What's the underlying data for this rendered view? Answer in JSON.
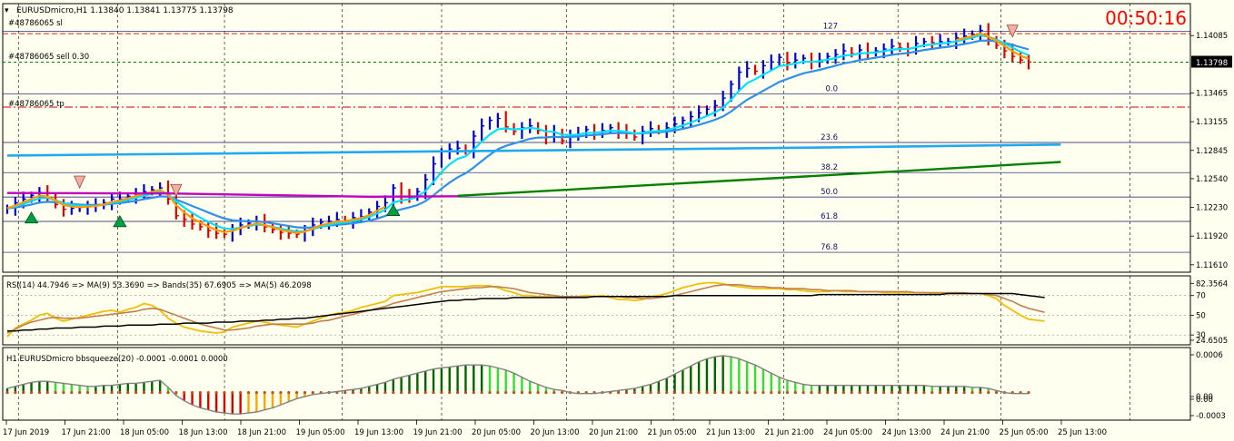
{
  "header": {
    "title": "EURUSDmicro,H1  1.13840 1.13841 1.13775 1.13798",
    "timer": "00:50:16"
  },
  "colors": {
    "background": "#fffff0",
    "frame": "#000000",
    "grid": "#000000",
    "bull": "#0000cd",
    "bear": "#e00000",
    "ma_fast": "#00e0ff",
    "ma_mid": "#3090e8",
    "ma_slow": "#20a8f0",
    "ma_long": "#008000",
    "ma_magenta": "#c000c0",
    "ma_orange": "#ff9900",
    "rsi": "#f0c000",
    "rsi_ma": "#c08050",
    "rsi_bands": "#000000",
    "hist_up_strong": "#006400",
    "hist_up_weak": "#33dd33",
    "hist_down_strong": "#dd0000",
    "hist_down_weak": "#ffa500",
    "timer": "#ff0000",
    "price_tag": "#000000"
  },
  "orders": {
    "sl": {
      "label": "#48786065 sl",
      "price": 1.14106
    },
    "entry": {
      "label": "#48786065 sell 0.30",
      "price": 1.13798
    },
    "tp": {
      "label": "#48786065 tp",
      "price": 1.13313
    }
  },
  "fibo": [
    {
      "label": "127",
      "price": 1.14133
    },
    {
      "label": "0.0",
      "price": 1.13457
    },
    {
      "label": "23.6",
      "price": 1.12931
    },
    {
      "label": "38.2",
      "price": 1.12606
    },
    {
      "label": "50.0",
      "price": 1.12342
    },
    {
      "label": "61.8",
      "price": 1.12079
    },
    {
      "label": "76.8",
      "price": 1.11745
    }
  ],
  "chart_data": [
    {
      "type": "bar",
      "title": "EURUSDmicro,H1",
      "ohlc_header": [
        "1.13840",
        "1.13841",
        "1.13775",
        "1.13798"
      ],
      "ylim": [
        1.1153,
        1.1443
      ],
      "y_ticks": [
        "1.14085",
        "1.13798",
        "1.13465",
        "1.13155",
        "1.12845",
        "1.12540",
        "1.12230",
        "1.11920",
        "1.11610"
      ],
      "current_price": "1.13798",
      "x_tick_labels": [
        "17 Jun 2019",
        "17 Jun 21:00",
        "18 Jun 05:00",
        "18 Jun 13:00",
        "18 Jun 21:00",
        "19 Jun 05:00",
        "19 Jun 13:00",
        "19 Jun 21:00",
        "20 Jun 05:00",
        "20 Jun 13:00",
        "20 Jun 21:00",
        "21 Jun 05:00",
        "21 Jun 13:00",
        "21 Jun 21:00",
        "24 Jun 05:00",
        "24 Jun 13:00",
        "24 Jun 21:00",
        "25 Jun 05:00",
        "25 Jun 13:00"
      ],
      "closes": [
        1.1222,
        1.1228,
        1.1232,
        1.1236,
        1.1239,
        1.1234,
        1.1226,
        1.1221,
        1.1222,
        1.1223,
        1.1224,
        1.1225,
        1.1228,
        1.1232,
        1.1232,
        1.1235,
        1.1238,
        1.124,
        1.1242,
        1.1244,
        1.1232,
        1.1214,
        1.121,
        1.1205,
        1.1202,
        1.1198,
        1.1195,
        1.1194,
        1.1199,
        1.1204,
        1.1206,
        1.1208,
        1.1202,
        1.1199,
        1.1196,
        1.1195,
        1.1194,
        1.1198,
        1.1204,
        1.1207,
        1.1208,
        1.121,
        1.1208,
        1.1212,
        1.1213,
        1.1218,
        1.1224,
        1.1228,
        1.1244,
        1.1235,
        1.1234,
        1.124,
        1.1253,
        1.127,
        1.1283,
        1.1286,
        1.1287,
        1.1284,
        1.13,
        1.1311,
        1.1317,
        1.1319,
        1.131,
        1.1305,
        1.1309,
        1.1311,
        1.1306,
        1.1299,
        1.1304,
        1.1295,
        1.1301,
        1.1302,
        1.1307,
        1.1304,
        1.1306,
        1.1309,
        1.1305,
        1.1303,
        1.1299,
        1.1305,
        1.1308,
        1.1306,
        1.1309,
        1.1313,
        1.1317,
        1.1321,
        1.1325,
        1.1329,
        1.1333,
        1.1341,
        1.1356,
        1.1369,
        1.1373,
        1.137,
        1.1376,
        1.138,
        1.1385,
        1.1379,
        1.1382,
        1.1384,
        1.138,
        1.1382,
        1.1386,
        1.1388,
        1.1392,
        1.1389,
        1.1393,
        1.139,
        1.1392,
        1.1394,
        1.1397,
        1.1395,
        1.1394,
        1.14,
        1.1402,
        1.1401,
        1.1402,
        1.1402,
        1.1406,
        1.1408,
        1.141,
        1.1414,
        1.1404,
        1.1398,
        1.1392,
        1.1386,
        1.1382,
        1.138
      ],
      "markers": [
        {
          "type": "sell-arrow",
          "index": 9
        },
        {
          "type": "buy-arrow",
          "index": 3
        },
        {
          "type": "buy-arrow",
          "index": 14
        },
        {
          "type": "sell-arrow",
          "index": 21
        },
        {
          "type": "buy-arrow",
          "index": 48
        },
        {
          "type": "sell-arrow",
          "index": 125
        }
      ]
    },
    {
      "type": "line",
      "title": "RSI(14) 44.7946  => MA(9) 53.3690  => Bands(35) 67.6905  => MA(5) 46.2098",
      "ylim": [
        20,
        90
      ],
      "y_ticks": [
        "82.3564",
        "70",
        "50",
        "30",
        "24.6505"
      ],
      "series": [
        {
          "name": "RSI(14)",
          "values": [
            28,
            37,
            41,
            45,
            50,
            52,
            47,
            44,
            46,
            48,
            50,
            52,
            54,
            55,
            53,
            56,
            58,
            62,
            60,
            55,
            47,
            42,
            38,
            36,
            34,
            33,
            32,
            33,
            38,
            40,
            42,
            44,
            43,
            41,
            40,
            39,
            38,
            41,
            44,
            47,
            50,
            52,
            53,
            55,
            58,
            60,
            62,
            64,
            70,
            71,
            72,
            73,
            75,
            77,
            79,
            79,
            79,
            79,
            80,
            80,
            80,
            78,
            75,
            73,
            70,
            70,
            69,
            69,
            70,
            68,
            68,
            69,
            70,
            69,
            70,
            68,
            66,
            66,
            65,
            66,
            69,
            70,
            72,
            75,
            78,
            80,
            82,
            83,
            83,
            82,
            80,
            79,
            78,
            77,
            77,
            77,
            77,
            76,
            76,
            75,
            74,
            74,
            74,
            75,
            74,
            74,
            74,
            74,
            74,
            73,
            73,
            73,
            73,
            73,
            73,
            72,
            72,
            72,
            72,
            72,
            72,
            72,
            70,
            67,
            60,
            55,
            50,
            46,
            45,
            44
          ]
        },
        {
          "name": "MA(9)",
          "values": [
            32,
            36,
            40,
            43,
            45,
            47,
            48,
            47,
            47,
            47,
            48,
            49,
            50,
            51,
            52,
            53,
            54,
            56,
            57,
            56,
            53,
            50,
            47,
            44,
            41,
            39,
            37,
            35,
            35,
            36,
            37,
            39,
            40,
            41,
            41,
            41,
            41,
            41,
            42,
            44,
            45,
            47,
            49,
            51,
            53,
            55,
            57,
            59,
            62,
            64,
            66,
            68,
            70,
            72,
            74,
            75,
            76,
            77,
            78,
            78,
            79,
            79,
            78,
            77,
            75,
            73,
            72,
            71,
            70,
            69,
            69,
            69,
            69,
            69,
            69,
            69,
            69,
            68,
            68,
            67,
            67,
            68,
            69,
            70,
            72,
            74,
            76,
            78,
            80,
            81,
            81,
            81,
            80,
            79,
            79,
            78,
            78,
            77,
            77,
            77,
            76,
            76,
            75,
            75,
            75,
            75,
            74,
            74,
            74,
            74,
            74,
            74,
            74,
            73,
            73,
            73,
            73,
            73,
            73,
            73,
            72,
            72,
            71,
            70,
            67,
            64,
            60,
            57,
            55,
            53
          ]
        },
        {
          "name": "Bands(35)",
          "values": [
            34,
            34,
            35,
            35,
            36,
            36,
            37,
            37,
            37,
            38,
            38,
            38,
            39,
            39,
            39,
            40,
            40,
            40,
            40,
            41,
            41,
            41,
            42,
            42,
            42,
            42,
            43,
            43,
            43,
            44,
            44,
            44,
            45,
            45,
            46,
            46,
            47,
            47,
            48,
            49,
            50,
            51,
            52,
            53,
            54,
            55,
            56,
            57,
            58,
            59,
            60,
            61,
            62,
            63,
            64,
            65,
            65,
            66,
            66,
            67,
            67,
            67,
            67,
            68,
            68,
            68,
            68,
            68,
            68,
            68,
            68,
            68,
            68,
            69,
            69,
            69,
            69,
            69,
            69,
            69,
            69,
            69,
            69,
            70,
            70,
            70,
            70,
            70,
            70,
            70,
            70,
            70,
            70,
            70,
            70,
            70,
            70,
            70,
            70,
            70,
            70,
            71,
            71,
            71,
            71,
            71,
            71,
            71,
            71,
            71,
            71,
            71,
            71,
            71,
            71,
            71,
            71,
            72,
            72,
            72,
            72,
            72,
            72,
            72,
            72,
            72,
            71,
            70,
            69,
            68
          ]
        }
      ]
    },
    {
      "type": "bar",
      "title": "H1 EURUSDmicro bbsqueeze(20) -0.0001 -0.0001 0.0000",
      "ylim": [
        -0.0027,
        0.0044
      ],
      "y_ticks": [
        "0.0006",
        "0.00",
        "0.00",
        "-0.0003"
      ],
      "values": [
        0.0004,
        0.0006,
        0.0008,
        0.001,
        0.0011,
        0.0011,
        0.001,
        0.0009,
        0.0008,
        0.0007,
        0.0006,
        0.0006,
        0.0007,
        0.0007,
        0.0008,
        0.0009,
        0.0009,
        0.001,
        0.0011,
        0.0012,
        0.0005,
        -0.0003,
        -0.0008,
        -0.0012,
        -0.0015,
        -0.0017,
        -0.0019,
        -0.002,
        -0.0021,
        -0.0021,
        -0.002,
        -0.0019,
        -0.0017,
        -0.0015,
        -0.0012,
        -0.0009,
        -0.0006,
        -0.0004,
        -0.0002,
        -0.0001,
        0.0,
        0.0001,
        0.0002,
        0.0003,
        0.0004,
        0.0006,
        0.0008,
        0.001,
        0.0013,
        0.0015,
        0.0017,
        0.0019,
        0.0021,
        0.0023,
        0.0024,
        0.0025,
        0.0026,
        0.0027,
        0.0027,
        0.0027,
        0.0026,
        0.0024,
        0.0022,
        0.0019,
        0.0015,
        0.0011,
        0.0008,
        0.0005,
        0.0003,
        0.0002,
        0.0,
        -0.0001,
        -0.0001,
        -0.0001,
        0.0,
        0.0001,
        0.0002,
        0.0003,
        0.0004,
        0.0006,
        0.0008,
        0.0011,
        0.0014,
        0.0018,
        0.0022,
        0.0026,
        0.003,
        0.0033,
        0.0035,
        0.0036,
        0.0035,
        0.0033,
        0.003,
        0.0027,
        0.0023,
        0.0019,
        0.0015,
        0.0012,
        0.001,
        0.0008,
        0.0007,
        0.0007,
        0.0007,
        0.0007,
        0.0007,
        0.0007,
        0.0007,
        0.0007,
        0.0007,
        0.0007,
        0.0007,
        0.0007,
        0.0007,
        0.0007,
        0.0007,
        0.0006,
        0.0006,
        0.0006,
        0.0006,
        0.0006,
        0.0005,
        0.0005,
        0.0004,
        0.0002,
        0.0,
        -0.0001,
        -0.0001,
        -0.0001
      ]
    }
  ]
}
